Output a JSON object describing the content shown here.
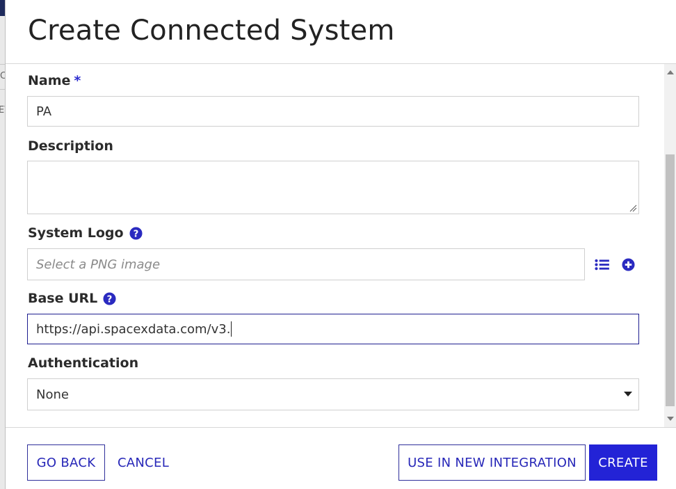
{
  "background_fragments": [
    "C",
    "EV"
  ],
  "dialog": {
    "title": "Create Connected System"
  },
  "form": {
    "name": {
      "label": "Name",
      "required_marker": "*",
      "value": "PA"
    },
    "description": {
      "label": "Description",
      "value": ""
    },
    "system_logo": {
      "label": "System Logo",
      "placeholder": "Select a PNG image",
      "help_icon": "question-circle-icon",
      "actions": [
        "list-icon",
        "add-circle-icon"
      ]
    },
    "base_url": {
      "label": "Base URL",
      "value": "https://api.spacexdata.com/v3.",
      "help_icon": "question-circle-icon"
    },
    "authentication": {
      "label": "Authentication",
      "selected": "None"
    }
  },
  "footer": {
    "go_back": "GO BACK",
    "cancel": "CANCEL",
    "use_in_new_integration": "USE IN NEW INTEGRATION",
    "create": "CREATE"
  },
  "colors": {
    "accent": "#2323d6",
    "link": "#2727b8",
    "help_icon": "#2a2ac0",
    "active_border": "#1d1d8f"
  }
}
